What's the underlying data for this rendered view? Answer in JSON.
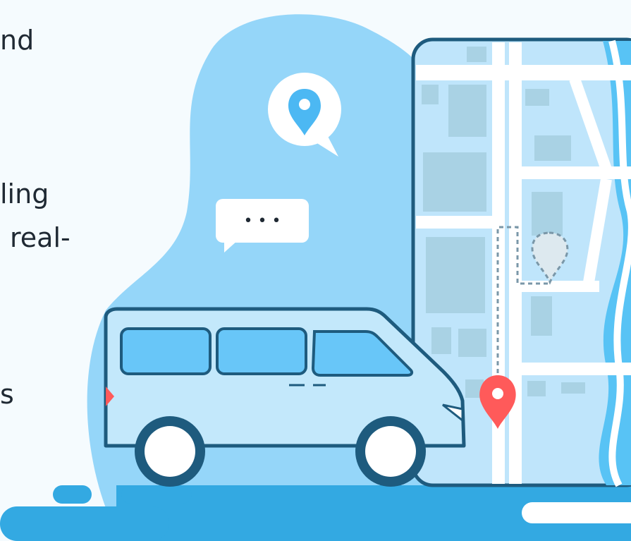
{
  "text_fragments": [
    "nd",
    "ling",
    "real-",
    "s"
  ],
  "chat_bubble": {
    "dots": "• • •"
  },
  "colors": {
    "background": "#f5fbfe",
    "blob": "#95d6f9",
    "road": "#33a9e2",
    "phone_outline": "#1e5b7e",
    "map": "#bfe5fb",
    "map_block": "#a9d2e4",
    "river": "#58c3f5",
    "van_body": "#c3e8fb",
    "van_window": "#68c6f8",
    "pin": "#ff5a5a"
  },
  "icons": [
    "location-pin-icon",
    "chat-bubble-icon",
    "destination-pin-icon",
    "van-illustration",
    "phone-map-illustration"
  ]
}
